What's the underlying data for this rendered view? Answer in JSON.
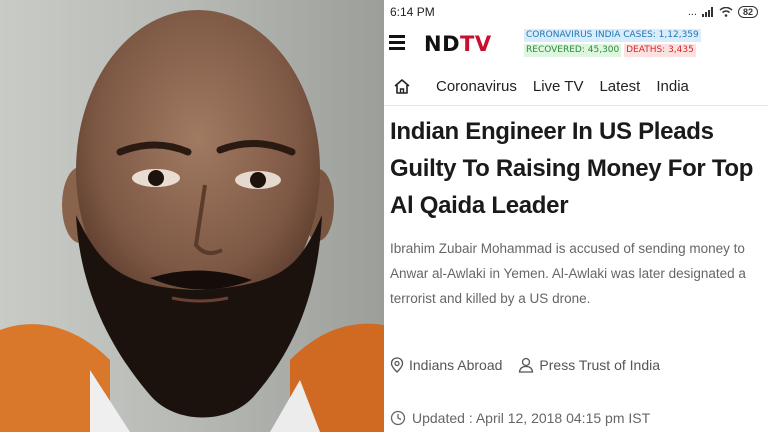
{
  "status_bar": {
    "time": "6:14 PM",
    "icons_text": "...",
    "battery": "82"
  },
  "header": {
    "logo_left": "ND",
    "logo_right": "TV",
    "covid_cases": "CORONAVIRUS INDIA CASES: 1,12,359",
    "covid_recovered": "RECOVERED: 45,300",
    "covid_deaths": "DEATHS: 3,435"
  },
  "nav": {
    "items": [
      "Coronavirus",
      "Live TV",
      "Latest",
      "India"
    ]
  },
  "article": {
    "headline": "Indian Engineer In US Pleads Guilty To Raising Money For Top Al Qaida Leader",
    "summary": "Ibrahim Zubair Mohammad is accused of sending money to Anwar al-Awlaki in Yemen. Al-Awlaki was later designated a terrorist and killed by a US drone.",
    "category": "Indians Abroad",
    "source": "Press Trust of India",
    "updated": "Updated : April 12, 2018 04:15 pm IST"
  },
  "colors": {
    "brand_red": "#c8102e",
    "cases_blue": "#1f77b4",
    "recovered_green": "#2e8b3a",
    "deaths_red": "#d62728"
  },
  "icons": [
    "menu-icon",
    "home-icon",
    "location-pin-icon",
    "person-icon",
    "clock-icon",
    "wifi-icon",
    "signal-icon"
  ]
}
